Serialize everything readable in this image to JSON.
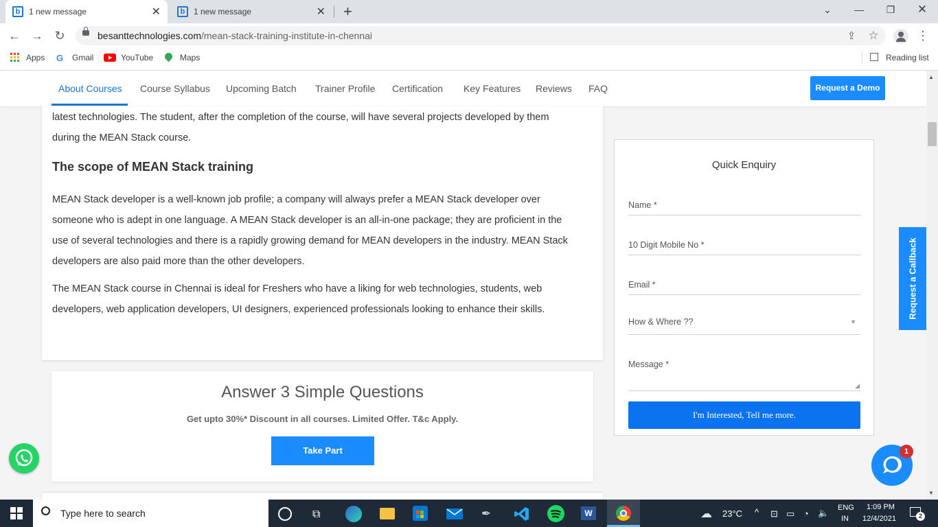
{
  "browser": {
    "tabs": [
      {
        "title": "1 new message",
        "favicon": "b-logo-icon",
        "active": true
      },
      {
        "title": "1 new message",
        "favicon": "b-logo-icon",
        "active": false
      }
    ],
    "url_host": "besanttechnologies.com",
    "url_path": "/mean-stack-training-institute-in-chennai",
    "bookmarks": [
      "Apps",
      "Gmail",
      "YouTube",
      "Maps"
    ],
    "reading_list": "Reading list"
  },
  "site_nav": {
    "links": [
      "About Courses",
      "Course Syllabus",
      "Upcoming Batch",
      "Trainer Profile",
      "Certification",
      "Key Features",
      "Reviews",
      "FAQ"
    ],
    "active_index": 0,
    "demo_button": "Request a Demo"
  },
  "content": {
    "intro_line1": "latest technologies. The student, after the completion of the course, will have several projects developed by them",
    "intro_line2": "during the MEAN Stack course.",
    "scope_heading": "The scope of MEAN Stack training",
    "para1_lines": [
      "MEAN Stack developer is a well-known job profile; a company will always prefer a MEAN Stack developer over",
      "someone who is adept in one language. A MEAN Stack developer is an all-in-one package; they are proficient in the",
      "use of several technologies and there is a rapidly growing demand for MEAN developers in the industry. MEAN Stack",
      "developers are also paid more than the other developers."
    ],
    "para2_lines": [
      "The MEAN Stack course in Chennai is ideal for Freshers who have a liking for web technologies, students, web",
      "developers, web application developers, UI designers, experienced professionals looking to enhance their skills."
    ]
  },
  "quiz": {
    "title": "Answer 3 Simple Questions",
    "subtitle": "Get upto 30%* Discount in all courses. Limited Offer. T&c Apply.",
    "button": "Take Part"
  },
  "enquiry": {
    "title": "Quick Enquiry",
    "name_placeholder": "Name *",
    "mobile_placeholder": "10 Digit Mobile No *",
    "email_placeholder": "Email *",
    "how_where": "How & Where ??",
    "message_placeholder": "Message *",
    "submit": "I'm Interested, Tell me more."
  },
  "callback": "Request a Callback",
  "chat_badge": "1",
  "taskbar": {
    "search_placeholder": "Type here to search",
    "weather": "23°C",
    "lang_line1": "ENG",
    "lang_line2": "IN",
    "time": "1:09 PM",
    "date": "12/4/2021",
    "notifications": "2"
  },
  "colors": {
    "accent": "#1a8cff",
    "nav_active": "#1976d2",
    "taskbar": "#1f2a38"
  }
}
